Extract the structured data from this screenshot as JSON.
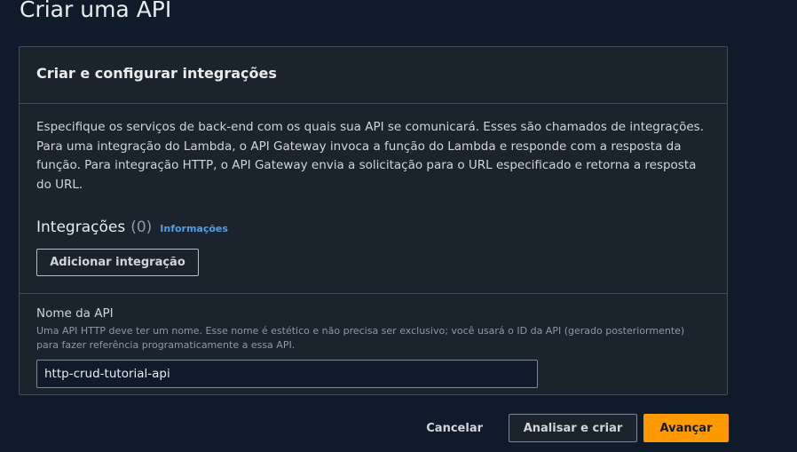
{
  "page": {
    "title": "Criar uma API"
  },
  "panel": {
    "title": "Criar e configurar integrações",
    "description": "Especifique os serviços de back-end com os quais sua API se comunicará. Esses são chamados de integrações. Para uma integração do Lambda, o API Gateway invoca a função do Lambda e responde com a resposta da função. Para integração HTTP, o API Gateway envia a solicitação para o URL especificado e retorna a resposta do URL.",
    "integrations_heading": "Integrações",
    "integrations_count": "(0)",
    "info_link": "Informações",
    "add_button": "Adicionar integração"
  },
  "api_name_field": {
    "label": "Nome da API",
    "description": "Uma API HTTP deve ter um nome. Esse nome é estético e não precisa ser exclusivo; você usará o ID da API (gerado posteriormente) para fazer referência programaticamente a essa API.",
    "value": "http-crud-tutorial-api"
  },
  "footer": {
    "cancel": "Cancelar",
    "review_create": "Analisar e criar",
    "next": "Avançar"
  },
  "colors": {
    "background": "#0f1b2a",
    "panel": "#1b232d",
    "primary": "#ff9900",
    "link": "#539fe5"
  }
}
